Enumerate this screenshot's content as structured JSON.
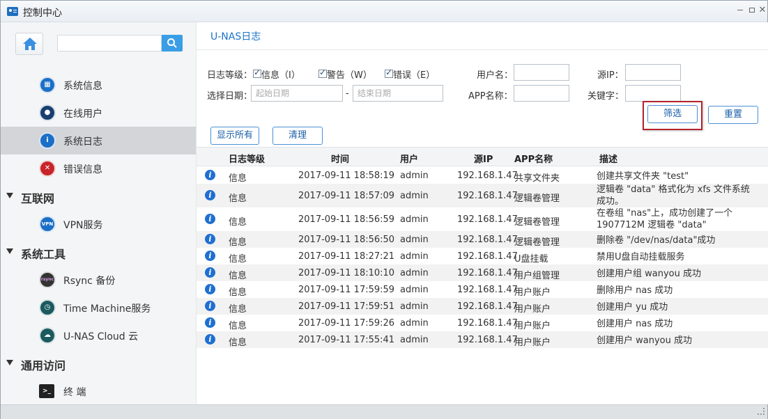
{
  "window": {
    "title": "控制中心"
  },
  "sidebar": {
    "items": [
      {
        "label": "系统信息",
        "icon": "system-info-icon"
      },
      {
        "label": "在线用户",
        "icon": "online-users-icon"
      },
      {
        "label": "系统日志",
        "icon": "system-log-icon",
        "active": true
      },
      {
        "label": "错误信息",
        "icon": "error-info-icon"
      }
    ],
    "groups": [
      {
        "label": "互联网",
        "items": [
          {
            "label": "VPN服务",
            "icon_text": "VPN"
          }
        ]
      },
      {
        "label": "系统工具",
        "items": [
          {
            "label": "Rsync 备份",
            "icon_text": "rsync"
          },
          {
            "label": "Time Machine服务"
          },
          {
            "label": "U-NAS Cloud 云"
          }
        ]
      },
      {
        "label": "通用访问",
        "items": [
          {
            "label": "终 端"
          }
        ]
      }
    ]
  },
  "main": {
    "title": "U-NAS日志",
    "filters": {
      "level_label": "日志等级：",
      "levels": [
        "信息（I）",
        "警告（W）",
        "错误（E）"
      ],
      "date_label": "选择日期：",
      "start_placeholder": "起始日期",
      "end_placeholder": "结束日期",
      "date_sep": "-",
      "username_label": "用户名：",
      "source_ip_label": "源IP：",
      "app_name_label": "APP名称：",
      "keyword_label": "关键字："
    },
    "buttons": {
      "filter": "筛选",
      "reset": "重置",
      "show_all": "显示所有",
      "clear": "清理"
    },
    "table": {
      "headers": {
        "level": "日志等级",
        "time": "时间",
        "user": "用户",
        "ip": "源IP",
        "app": "APP名称",
        "desc": "描述"
      },
      "rows": [
        {
          "level": "信息",
          "time": "2017-09-11 18:58:19",
          "user": "admin",
          "ip": "192.168.1.47",
          "app": "共享文件夹",
          "desc": "创建共享文件夹 \"test\""
        },
        {
          "level": "信息",
          "time": "2017-09-11 18:57:09",
          "user": "admin",
          "ip": "192.168.1.47",
          "app": "逻辑卷管理",
          "desc": "逻辑卷 \"data\" 格式化为 xfs 文件系统成功。"
        },
        {
          "level": "信息",
          "time": "2017-09-11 18:56:59",
          "user": "admin",
          "ip": "192.168.1.47",
          "app": "逻辑卷管理",
          "desc": "在卷组 \"nas\"上，成功创建了一个 1907712M 逻辑卷 \"data\""
        },
        {
          "level": "信息",
          "time": "2017-09-11 18:56:50",
          "user": "admin",
          "ip": "192.168.1.47",
          "app": "逻辑卷管理",
          "desc": "删除卷 \"/dev/nas/data\"成功"
        },
        {
          "level": "信息",
          "time": "2017-09-11 18:27:21",
          "user": "admin",
          "ip": "192.168.1.47",
          "app": "U盘挂载",
          "desc": "禁用U盘自动挂载服务"
        },
        {
          "level": "信息",
          "time": "2017-09-11 18:10:10",
          "user": "admin",
          "ip": "192.168.1.47",
          "app": "用户组管理",
          "desc": "创建用户组 wanyou 成功"
        },
        {
          "level": "信息",
          "time": "2017-09-11 17:59:59",
          "user": "admin",
          "ip": "192.168.1.47",
          "app": "用户账户",
          "desc": "删除用户 nas 成功"
        },
        {
          "level": "信息",
          "time": "2017-09-11 17:59:51",
          "user": "admin",
          "ip": "192.168.1.47",
          "app": "用户账户",
          "desc": "创建用户 yu 成功"
        },
        {
          "level": "信息",
          "time": "2017-09-11 17:59:26",
          "user": "admin",
          "ip": "192.168.1.47",
          "app": "用户账户",
          "desc": "创建用户 nas 成功"
        },
        {
          "level": "信息",
          "time": "2017-09-11 17:55:41",
          "user": "admin",
          "ip": "192.168.1.47",
          "app": "用户账户",
          "desc": "创建用户 wanyou 成功"
        }
      ]
    }
  },
  "colors": {
    "accent": "#1a73c7",
    "highlight": "#b4232c",
    "info": "#1f6fd1"
  }
}
